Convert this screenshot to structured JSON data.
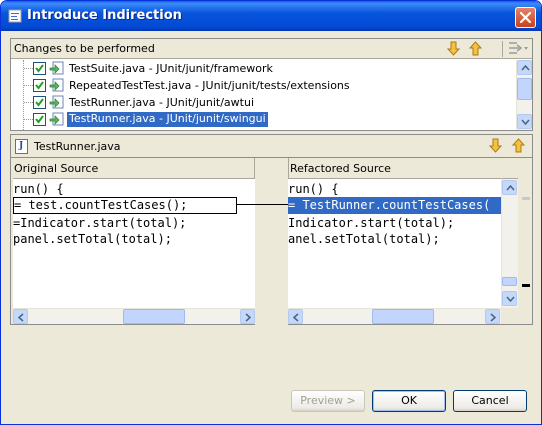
{
  "window": {
    "title": "Introduce Indirection"
  },
  "changes": {
    "label": "Changes to be performed",
    "items": [
      {
        "label": "TestSuite.java - JUnit/junit/framework",
        "checked": true,
        "selected": false
      },
      {
        "label": "RepeatedTestTest.java - JUnit/junit/tests/extensions",
        "checked": true,
        "selected": false
      },
      {
        "label": "TestRunner.java - JUnit/junit/awtui",
        "checked": true,
        "selected": false
      },
      {
        "label": "TestRunner.java - JUnit/junit/swingui",
        "checked": true,
        "selected": true
      }
    ]
  },
  "file": {
    "name": "TestRunner.java",
    "icon_letter": "J"
  },
  "compare": {
    "original_title": "Original Source",
    "refactored_title": "Refactored Source",
    "original_lines": [
      "run() {",
      "= test.countTestCases();",
      "=Indicator.start(total);",
      "panel.setTotal(total);"
    ],
    "refactored_lines": [
      "run() {",
      "= TestRunner.countTestCases(",
      "Indicator.start(total);",
      "anel.setTotal(total);"
    ]
  },
  "buttons": {
    "preview": "Preview >",
    "ok": "OK",
    "cancel": "Cancel"
  },
  "colors": {
    "selection": "#316ac5",
    "titlebar": "#0855dd",
    "dialog_bg": "#ece9d8",
    "arrow_orange": "#e8a317"
  }
}
